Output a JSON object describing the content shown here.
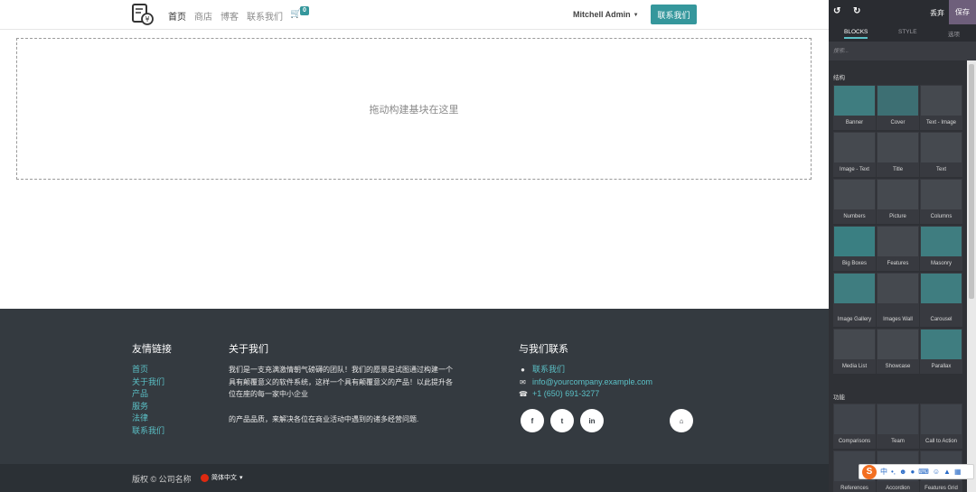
{
  "header": {
    "nav": [
      "首页",
      "商店",
      "博客",
      "联系我们"
    ],
    "cart_count": "0",
    "user": "Mitchell Admin",
    "contact_button": "联系我们"
  },
  "dropzone": {
    "text": "拖动构建基块在这里"
  },
  "footer": {
    "links_title": "友情链接",
    "links": [
      "首页",
      "关于我们",
      "产品",
      "服务",
      "法律",
      "联系我们"
    ],
    "about_title": "关于我们",
    "about_text": "我们是一支充满激情朝气磅礴的团队！我们的愿景是试图通过构建一个具有颠覆意义的软件系统，这样一个具有颠覆意义的产品！以此提升各位在座的每一家中小企业",
    "about_text2": "的产品品质，来解决各位在商业活动中遇到的诸多经营问题.",
    "contact_title": "与我们联系",
    "contact_items": [
      {
        "icon": "chat-icon",
        "text": "联系我们"
      },
      {
        "icon": "envelope-icon",
        "text": "info@yourcompany.example.com"
      },
      {
        "icon": "phone-icon",
        "text": "+1 (650) 691-3277"
      }
    ],
    "social": [
      "f",
      "t",
      "in"
    ],
    "copyright": "版权 © 公司名称",
    "language": "简体中文"
  },
  "editor": {
    "discard": "丢弃",
    "save": "保存",
    "tabs": [
      "BLOCKS",
      "STYLE",
      "选项"
    ],
    "search_placeholder": "搜索...",
    "section_structure": "结构",
    "structure_blocks": [
      "Banner",
      "Cover",
      "Text - Image",
      "Image - Text",
      "Title",
      "Text",
      "Numbers",
      "Picture",
      "Columns",
      "Big Boxes",
      "Features",
      "Masonry",
      "Image Gallery",
      "Images Wall",
      "Carousel",
      "Media List",
      "Showcase",
      "Parallax"
    ],
    "section_features": "功能",
    "feature_blocks": [
      "Comparisons",
      "Team",
      "Call to Action",
      "References",
      "Accordion",
      "Features Grid"
    ]
  },
  "ime": {
    "label": "中"
  }
}
